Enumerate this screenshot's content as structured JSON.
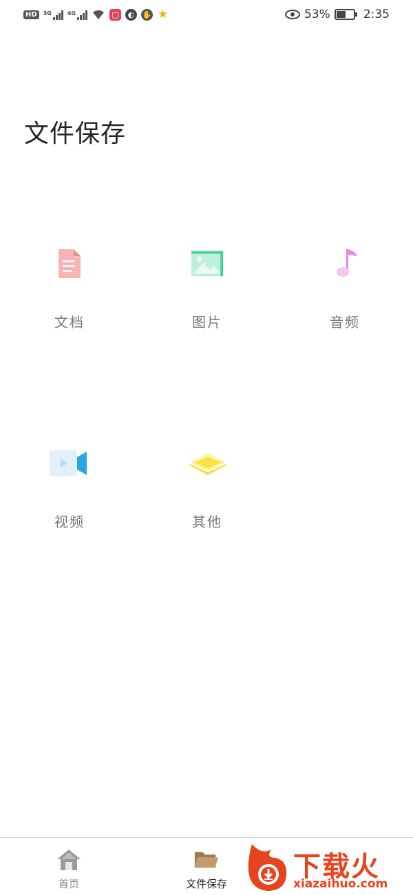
{
  "status_bar": {
    "hd_badge": "HD",
    "net1": "3G",
    "net2": "4G",
    "battery_percent": "53%",
    "time": "2:35"
  },
  "page": {
    "title": "文件保存"
  },
  "categories": [
    {
      "label": "文档",
      "icon": "document-icon",
      "color": "#f39a9a"
    },
    {
      "label": "图片",
      "icon": "image-icon",
      "color": "#3fd49a"
    },
    {
      "label": "音频",
      "icon": "music-note-icon",
      "color": "#e08ae8"
    },
    {
      "label": "视频",
      "icon": "video-camera-icon",
      "color": "#2aa6e8"
    },
    {
      "label": "其他",
      "icon": "layers-icon",
      "color": "#f7e02a"
    }
  ],
  "bottom_nav": {
    "items": [
      {
        "label": "首页",
        "icon": "home-icon",
        "active": false
      },
      {
        "label": "文件保存",
        "icon": "folder-open-icon",
        "active": true
      }
    ]
  },
  "watermark": {
    "text": "下载火",
    "url": "xiazaihuo.com",
    "color": "#e8431f"
  }
}
